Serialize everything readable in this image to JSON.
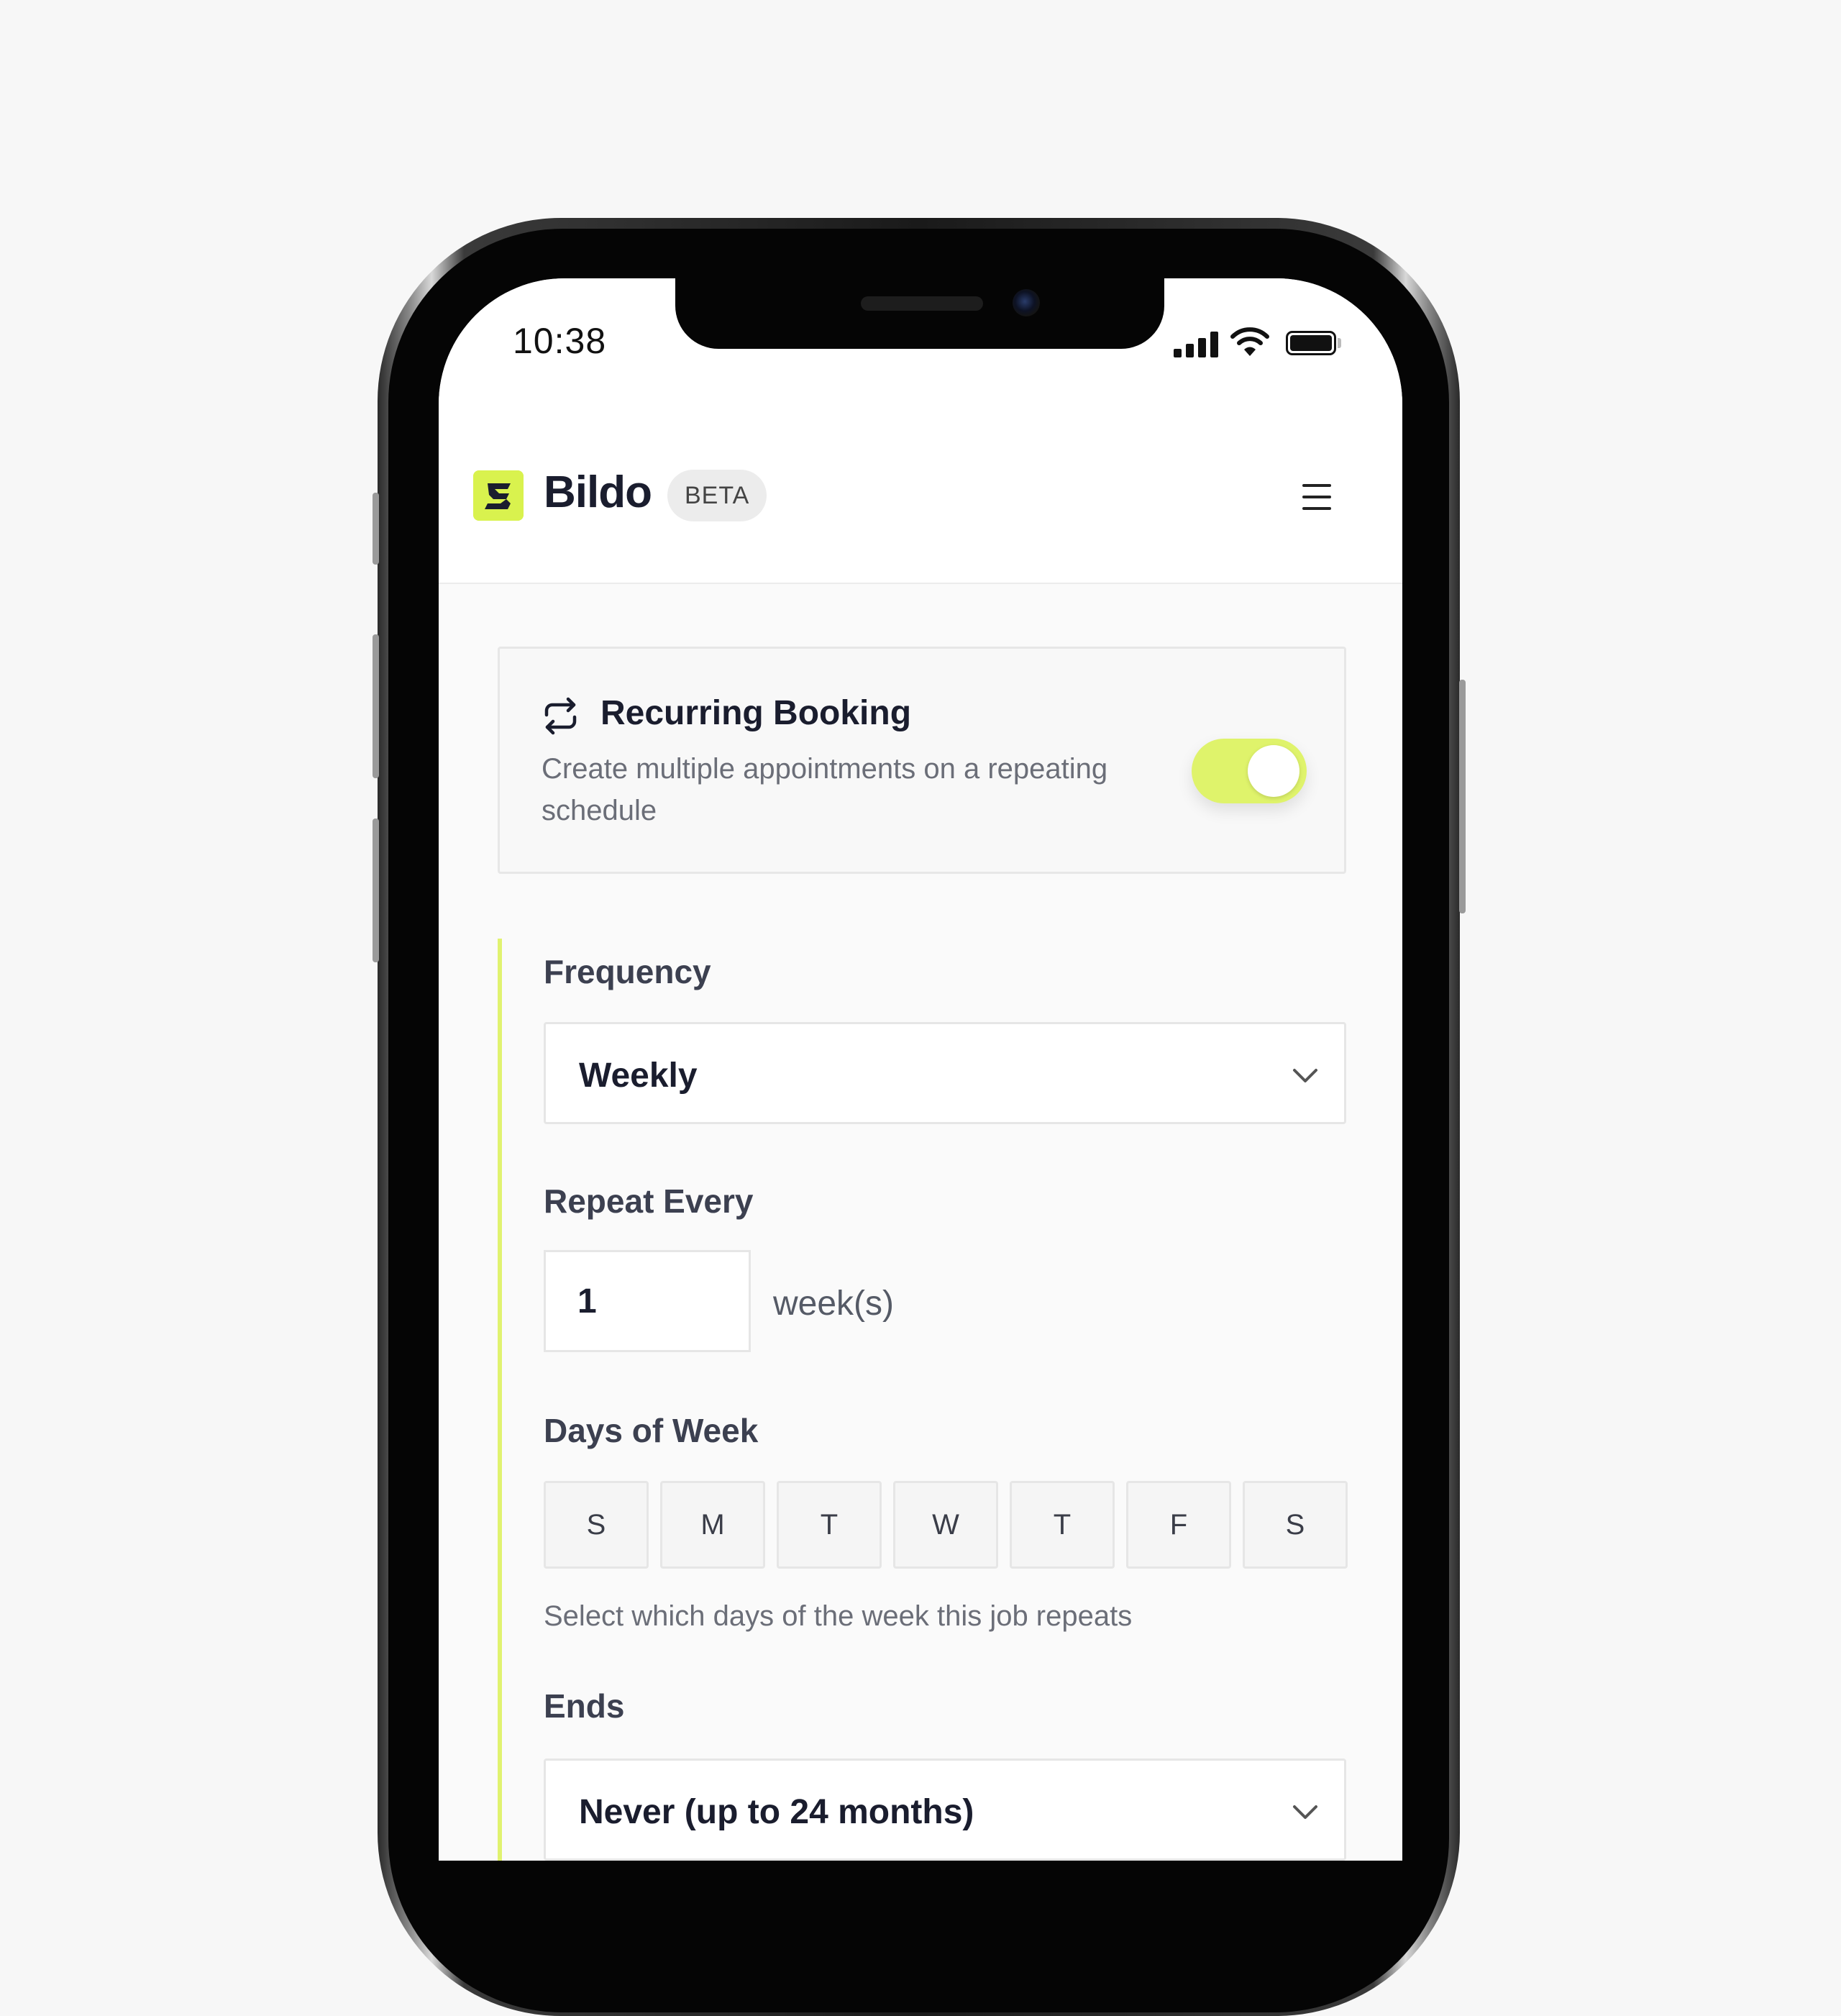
{
  "status_bar": {
    "time": "10:38"
  },
  "header": {
    "brand": "Bildo",
    "badge": "BETA"
  },
  "recurring": {
    "title": "Recurring Booking",
    "description": "Create multiple appointments on a repeating schedule",
    "enabled": true
  },
  "form": {
    "frequency": {
      "label": "Frequency",
      "value": "Weekly"
    },
    "repeat_every": {
      "label": "Repeat Every",
      "value": "1",
      "unit": "week(s)"
    },
    "days_of_week": {
      "label": "Days of Week",
      "days": [
        "S",
        "M",
        "T",
        "W",
        "T",
        "F",
        "S"
      ],
      "help": "Select which days of the week this job repeats"
    },
    "ends": {
      "label": "Ends",
      "value": "Never (up to 24 months)"
    }
  },
  "colors": {
    "accent": "#dff36b",
    "logo_bg": "#d9f24e",
    "text_dark": "#1a1d2e"
  }
}
